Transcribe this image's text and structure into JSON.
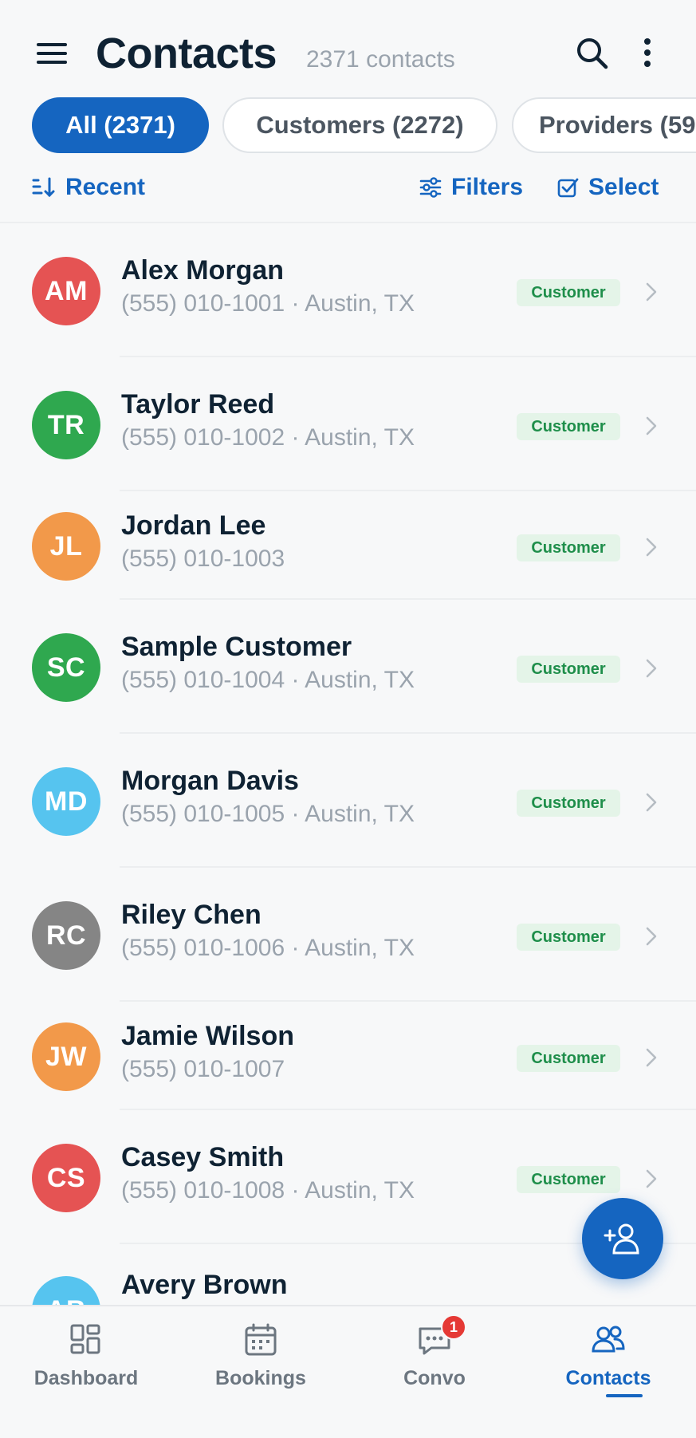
{
  "header": {
    "title": "Contacts",
    "subtitle": "2371 contacts"
  },
  "chips": [
    {
      "label": "All (2371)",
      "active": true
    },
    {
      "label": "Customers (2272)",
      "active": false
    },
    {
      "label": "Providers (59",
      "active": false
    }
  ],
  "toolbar": {
    "sort_label": "Recent",
    "filters_label": "Filters",
    "select_label": "Select"
  },
  "contacts": [
    {
      "initials": "AM",
      "name": "Alex Morgan",
      "meta": "(555) 010-1001 · Austin, TX",
      "badge": "Customer",
      "color": "#e55353"
    },
    {
      "initials": "TR",
      "name": "Taylor Reed",
      "meta": "(555) 010-1002 · Austin, TX",
      "badge": "Customer",
      "color": "#2fa84f"
    },
    {
      "initials": "JL",
      "name": "Jordan Lee",
      "meta": "(555) 010-1003",
      "badge": "Customer",
      "color": "#f2994a"
    },
    {
      "initials": "SC",
      "name": "Sample Customer",
      "meta": "(555) 010-1004 · Austin, TX",
      "badge": "Customer",
      "color": "#2fa84f"
    },
    {
      "initials": "MD",
      "name": "Morgan Davis",
      "meta": "(555) 010-1005 · Austin, TX",
      "badge": "Customer",
      "color": "#56c4ef"
    },
    {
      "initials": "RC",
      "name": "Riley Chen",
      "meta": "(555) 010-1006 · Austin, TX",
      "badge": "Customer",
      "color": "#858585"
    },
    {
      "initials": "JW",
      "name": "Jamie Wilson",
      "meta": "(555) 010-1007",
      "badge": "Customer",
      "color": "#f2994a"
    },
    {
      "initials": "CS",
      "name": "Casey Smith",
      "meta": "(555) 010-1008 · Austin, TX",
      "badge": "Customer",
      "color": "#e55353"
    },
    {
      "initials": "AB",
      "name": "Avery Brown",
      "meta": "",
      "badge": "",
      "color": "#56c4ef"
    }
  ],
  "bottom_nav": [
    {
      "label": "Dashboard",
      "icon": "dashboard-icon"
    },
    {
      "label": "Bookings",
      "icon": "calendar-icon"
    },
    {
      "label": "Convo",
      "icon": "chat-icon",
      "badge": "1"
    },
    {
      "label": "Contacts",
      "icon": "contacts-icon",
      "active": true
    }
  ],
  "fab": {
    "icon": "add-contact-icon"
  },
  "colors": {
    "accent": "#1565c0",
    "badge_bg": "#e4f4e8",
    "badge_text": "#1e8e4a"
  }
}
